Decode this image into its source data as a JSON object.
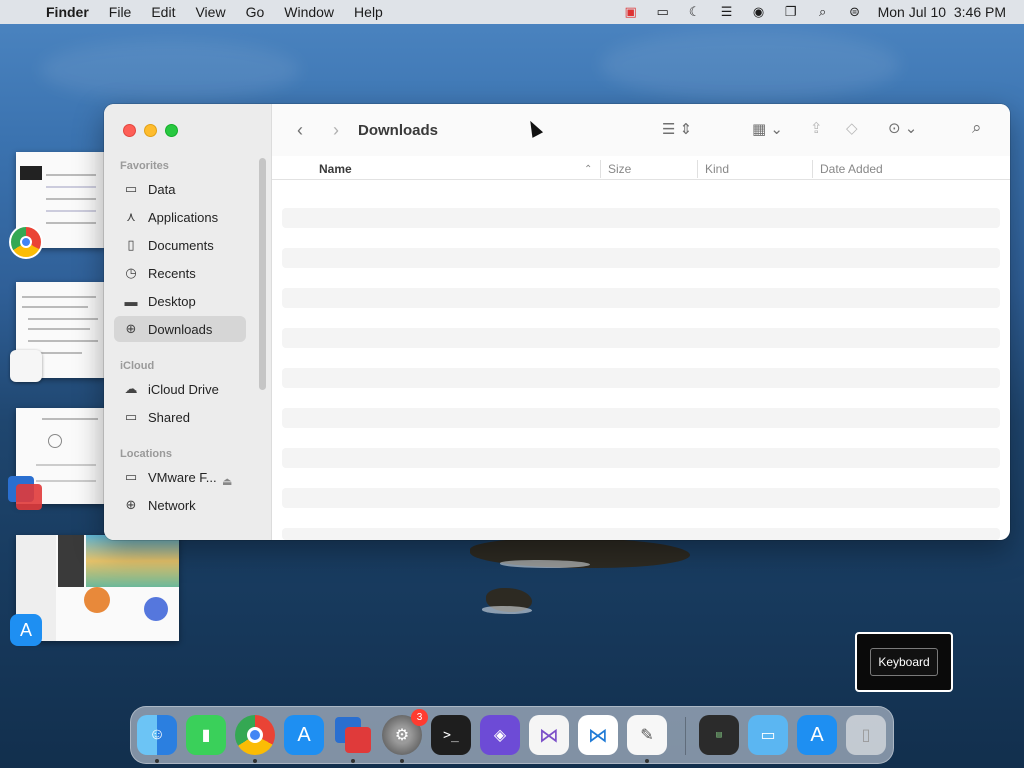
{
  "menubar": {
    "app": "Finder",
    "items": [
      "File",
      "Edit",
      "View",
      "Go",
      "Window",
      "Help"
    ],
    "clock": "Mon Jul 10  3:46 PM"
  },
  "finder": {
    "title": "Downloads",
    "sidebar": {
      "favorites_label": "Favorites",
      "favorites": [
        {
          "label": "Data",
          "icon": "folder-icon"
        },
        {
          "label": "Applications",
          "icon": "applications-icon"
        },
        {
          "label": "Documents",
          "icon": "document-icon"
        },
        {
          "label": "Recents",
          "icon": "clock-icon"
        },
        {
          "label": "Desktop",
          "icon": "desktop-icon"
        },
        {
          "label": "Downloads",
          "icon": "download-icon"
        }
      ],
      "icloud_label": "iCloud",
      "icloud": [
        {
          "label": "iCloud Drive",
          "icon": "cloud-icon"
        },
        {
          "label": "Shared",
          "icon": "shared-folder-icon"
        }
      ],
      "locations_label": "Locations",
      "locations": [
        {
          "label": "VMware F...",
          "icon": "drive-icon"
        },
        {
          "label": "Network",
          "icon": "globe-icon"
        }
      ]
    },
    "columns": [
      "Name",
      "Size",
      "Kind",
      "Date Added"
    ]
  },
  "keyboard_popup": {
    "label": "Keyboard"
  },
  "dock": {
    "settings_badge": "3"
  }
}
